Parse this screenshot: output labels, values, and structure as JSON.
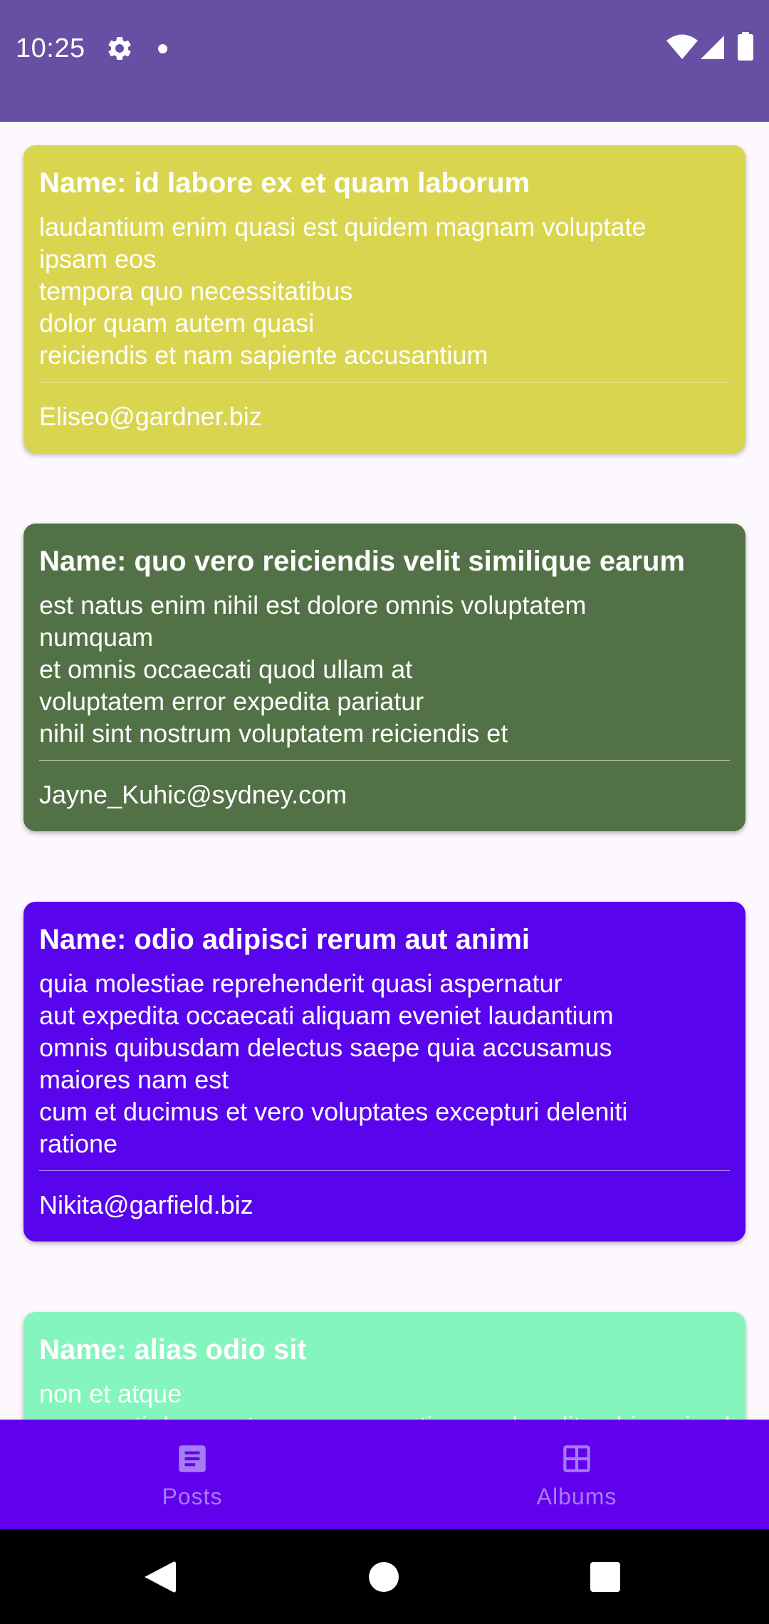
{
  "status_bar": {
    "time": "10:25",
    "background": "#6750a4"
  },
  "posts": [
    {
      "title": "Name: id labore ex et quam laborum",
      "body_lines": [
        "laudantium enim quasi est quidem magnam voluptate",
        "ipsam eos",
        "tempora quo necessitatibus",
        "dolor quam autem quasi",
        "reiciendis et nam sapiente accusantium"
      ],
      "email": "Eliseo@gardner.biz",
      "color": "#d9d54f"
    },
    {
      "title": "Name: quo vero reiciendis velit similique earum",
      "body_lines": [
        "est natus enim nihil est dolore omnis voluptatem",
        "numquam",
        "et omnis occaecati quod ullam at",
        "voluptatem error expedita pariatur",
        "nihil sint nostrum voluptatem reiciendis et"
      ],
      "email": "Jayne_Kuhic@sydney.com",
      "color": "#537146"
    },
    {
      "title": "Name: odio adipisci rerum aut animi",
      "body_lines": [
        "quia molestiae reprehenderit quasi aspernatur",
        "aut expedita occaecati aliquam eveniet laudantium",
        "omnis quibusdam delectus saepe quia accusamus",
        "maiores nam est",
        "cum et ducimus et vero voluptates excepturi deleniti",
        "ratione"
      ],
      "email": "Nikita@garfield.biz",
      "color": "#5804ec"
    },
    {
      "title": "Name: alias odio sit",
      "body_lines": [
        "non et atque",
        "occaecati deserunt quas accusantium unde odit nobis qui voluptatem"
      ],
      "email": "",
      "color": "#85f5be"
    }
  ],
  "bottom_nav": {
    "items": [
      {
        "label": "Posts",
        "icon": "posts-icon"
      },
      {
        "label": "Albums",
        "icon": "albums-icon"
      }
    ],
    "background": "#6200ee",
    "item_color": "#a57cf2"
  },
  "system_nav": {
    "buttons": [
      "back-icon",
      "home-icon",
      "recents-icon"
    ]
  }
}
